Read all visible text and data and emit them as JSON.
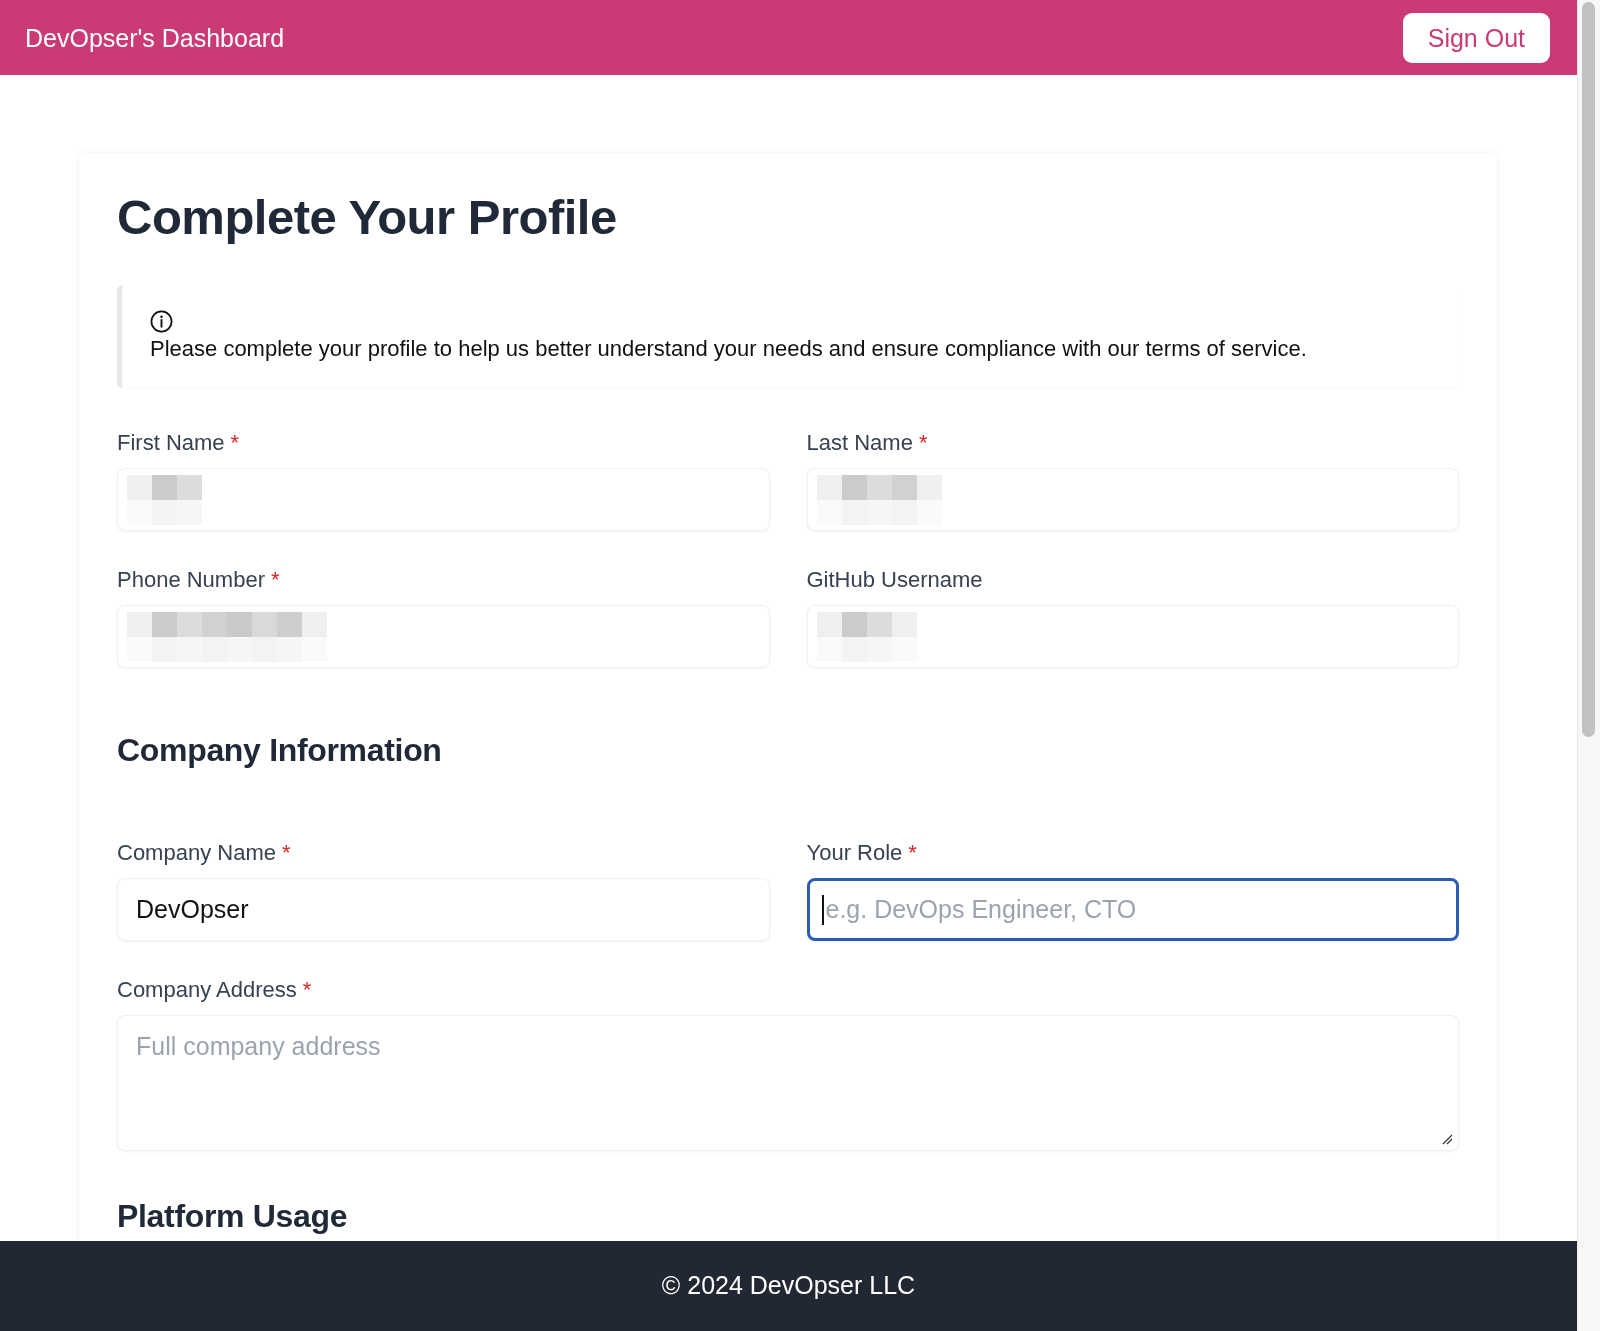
{
  "navbar": {
    "title": "DevOpser's Dashboard",
    "sign_out_button": "Sign Out"
  },
  "profile_card": {
    "title": "Complete Your Profile",
    "notice": "Please complete your profile to help us better understand your needs and ensure compliance with our terms of service.",
    "required_mark": "*",
    "field_groups": [
      {
        "fields": [
          {
            "label": "First Name",
            "required": true,
            "kind": "input",
            "redacted": true,
            "focused": false
          },
          {
            "label": "Last Name",
            "required": true,
            "kind": "input",
            "redacted": true,
            "focused": false
          },
          {
            "label": "Phone Number",
            "required": true,
            "kind": "input",
            "redacted": true,
            "focused": false
          },
          {
            "label": "GitHub Username",
            "required": false,
            "kind": "input",
            "redacted": true,
            "focused": false
          }
        ]
      },
      {
        "title": "Company Information",
        "fields": [
          {
            "label": "Company Name",
            "required": true,
            "kind": "input",
            "value": "DevOpser",
            "focused": false
          },
          {
            "label": "Your Role",
            "required": true,
            "kind": "input",
            "placeholder": "e.g. DevOps Engineer, CTO",
            "focused": true
          },
          {
            "label": "Company Address",
            "required": true,
            "kind": "textarea",
            "placeholder": "Full company address",
            "focused": false
          }
        ]
      },
      {
        "title": "Platform Usage"
      }
    ]
  },
  "footer": {
    "text": "© 2024 DevOpser LLC"
  }
}
